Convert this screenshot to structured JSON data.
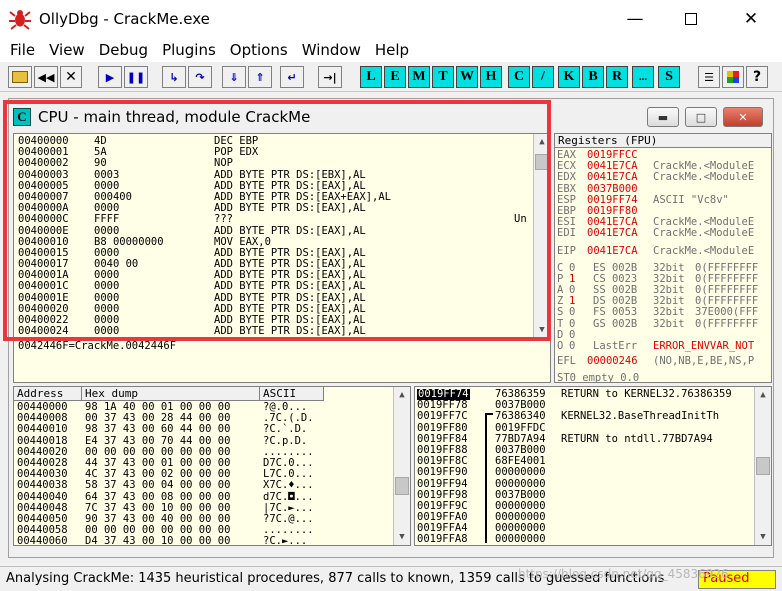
{
  "window": {
    "title": "OllyDbg - CrackMe.exe"
  },
  "menu": [
    "File",
    "View",
    "Debug",
    "Plugins",
    "Options",
    "Window",
    "Help"
  ],
  "toolbar_letters": [
    "L",
    "E",
    "M",
    "T",
    "W",
    "H",
    "C",
    "/",
    "K",
    "B",
    "R",
    "...",
    "S"
  ],
  "cpu": {
    "title": "CPU - main thread, module CrackMe"
  },
  "disasm": {
    "rows": [
      {
        "addr": "00400000",
        "hex": "4D",
        "instr": "DEC EBP"
      },
      {
        "addr": "00400001",
        "hex": "5A",
        "instr": "POP EDX"
      },
      {
        "addr": "00400002",
        "hex": "90",
        "instr": "NOP"
      },
      {
        "addr": "00400003",
        "hex": "0003",
        "instr": "ADD BYTE PTR DS:[EBX],AL"
      },
      {
        "addr": "00400005",
        "hex": "0000",
        "instr": "ADD BYTE PTR DS:[EAX],AL"
      },
      {
        "addr": "00400007",
        "hex": "000400",
        "instr": "ADD BYTE PTR DS:[EAX+EAX],AL"
      },
      {
        "addr": "0040000A",
        "hex": "0000",
        "instr": "ADD BYTE PTR DS:[EAX],AL"
      },
      {
        "addr": "0040000C",
        "hex": "FFFF",
        "instr": "???"
      },
      {
        "addr": "0040000E",
        "hex": "0000",
        "instr": "ADD BYTE PTR DS:[EAX],AL"
      },
      {
        "addr": "00400010",
        "hex": "B8 00000000",
        "instr": "MOV EAX,0"
      },
      {
        "addr": "00400015",
        "hex": "0000",
        "instr": "ADD BYTE PTR DS:[EAX],AL"
      },
      {
        "addr": "00400017",
        "hex": "0040 00",
        "instr": "ADD BYTE PTR DS:[EAX],AL"
      },
      {
        "addr": "0040001A",
        "hex": "0000",
        "instr": "ADD BYTE PTR DS:[EAX],AL"
      },
      {
        "addr": "0040001C",
        "hex": "0000",
        "instr": "ADD BYTE PTR DS:[EAX],AL"
      },
      {
        "addr": "0040001E",
        "hex": "0000",
        "instr": "ADD BYTE PTR DS:[EAX],AL"
      },
      {
        "addr": "00400020",
        "hex": "0000",
        "instr": "ADD BYTE PTR DS:[EAX],AL"
      },
      {
        "addr": "00400022",
        "hex": "0000",
        "instr": "ADD BYTE PTR DS:[EAX],AL"
      },
      {
        "addr": "00400024",
        "hex": "0000",
        "instr": "ADD BYTE PTR DS:[EAX],AL"
      }
    ],
    "comment": "Un",
    "info_line": "0042446F=CrackMe.0042446F"
  },
  "registers": {
    "header": "Registers (FPU)",
    "rows": [
      {
        "name": "EAX",
        "value": "0019FFCC",
        "comment": ""
      },
      {
        "name": "ECX",
        "value": "0041E7CA",
        "comment": "CrackMe.<ModuleE"
      },
      {
        "name": "EDX",
        "value": "0041E7CA",
        "comment": "CrackMe.<ModuleE"
      },
      {
        "name": "EBX",
        "value": "0037B000",
        "comment": ""
      },
      {
        "name": "ESP",
        "value": "0019FF74",
        "comment": "ASCII \"Vc8v\""
      },
      {
        "name": "EBP",
        "value": "0019FF80",
        "comment": ""
      },
      {
        "name": "ESI",
        "value": "0041E7CA",
        "comment": "CrackMe.<ModuleE"
      },
      {
        "name": "EDI",
        "value": "0041E7CA",
        "comment": "CrackMe.<ModuleE"
      },
      {
        "name": "EIP",
        "value": "0041E7CA",
        "comment": "CrackMe.<ModuleE"
      }
    ],
    "flags": [
      {
        "f": "C",
        "v": "0",
        "seg": "ES 002B",
        "bits": "32bit",
        "base": "0(FFFFFFFF"
      },
      {
        "f": "P",
        "v": "1",
        "seg": "CS 0023",
        "bits": "32bit",
        "base": "0(FFFFFFFF"
      },
      {
        "f": "A",
        "v": "0",
        "seg": "SS 002B",
        "bits": "32bit",
        "base": "0(FFFFFFFF"
      },
      {
        "f": "Z",
        "v": "1",
        "seg": "DS 002B",
        "bits": "32bit",
        "base": "0(FFFFFFFF"
      },
      {
        "f": "S",
        "v": "0",
        "seg": "FS 0053",
        "bits": "32bit",
        "base": "37E000(FFF"
      },
      {
        "f": "T",
        "v": "0",
        "seg": "GS 002B",
        "bits": "32bit",
        "base": "0(FFFFFFFF"
      },
      {
        "f": "D",
        "v": "0",
        "seg": "",
        "bits": "",
        "base": ""
      }
    ],
    "lasterr": {
      "f": "O",
      "v": "0",
      "label": "LastErr",
      "value": "ERROR_ENVVAR_NOT"
    },
    "efl": {
      "label": "EFL",
      "value": "00000246",
      "desc": "(NO,NB,E,BE,NS,P"
    },
    "st0": "ST0 empty 0.0"
  },
  "dump": {
    "headers": [
      "Address",
      "Hex dump",
      "ASCII"
    ],
    "rows": [
      {
        "addr": "00440000",
        "hex": "98 1A 40 00 01 00 00 00",
        "ascii": "?@.0..."
      },
      {
        "addr": "00440008",
        "hex": "00 37 43 00 28 44 00 00",
        "ascii": ".7C.(.D."
      },
      {
        "addr": "00440010",
        "hex": "98 37 43 00 60 44 00 00",
        "ascii": "?C.`.D."
      },
      {
        "addr": "00440018",
        "hex": "E4 37 43 00 70 44 00 00",
        "ascii": "?C.p.D."
      },
      {
        "addr": "00440020",
        "hex": "00 00 00 00 00 00 00 00",
        "ascii": "........"
      },
      {
        "addr": "00440028",
        "hex": "44 37 43 00 01 00 00 00",
        "ascii": "D7C.0..."
      },
      {
        "addr": "00440030",
        "hex": "4C 37 43 00 02 00 00 00",
        "ascii": "L7C.0..."
      },
      {
        "addr": "00440038",
        "hex": "58 37 43 00 04 00 00 00",
        "ascii": "X7C.♦..."
      },
      {
        "addr": "00440040",
        "hex": "64 37 43 00 08 00 00 00",
        "ascii": "d7C.◘..."
      },
      {
        "addr": "00440048",
        "hex": "7C 37 43 00 10 00 00 00",
        "ascii": "|7C.►..."
      },
      {
        "addr": "00440050",
        "hex": "90 37 43 00 40 00 00 00",
        "ascii": "?7C.@..."
      },
      {
        "addr": "00440058",
        "hex": "00 00 00 00 00 00 00 00",
        "ascii": "........"
      },
      {
        "addr": "00440060",
        "hex": "D4 37 43 00 10 00 00 00",
        "ascii": "?C.►..."
      }
    ]
  },
  "stack": {
    "rows": [
      {
        "addr": "0019FF74",
        "val": "76386359",
        "comment": "RETURN to KERNEL32.76386359"
      },
      {
        "addr": "0019FF78",
        "val": "0037B000",
        "comment": ""
      },
      {
        "addr": "0019FF7C",
        "val": "76386340",
        "comment": "KERNEL32.BaseThreadInitTh"
      },
      {
        "addr": "0019FF80",
        "val": "0019FFDC",
        "comment": ""
      },
      {
        "addr": "0019FF84",
        "val": "77BD7A94",
        "comment": "RETURN to ntdll.77BD7A94"
      },
      {
        "addr": "0019FF88",
        "val": "0037B000",
        "comment": ""
      },
      {
        "addr": "0019FF8C",
        "val": "68FE4001",
        "comment": ""
      },
      {
        "addr": "0019FF90",
        "val": "00000000",
        "comment": ""
      },
      {
        "addr": "0019FF94",
        "val": "00000000",
        "comment": ""
      },
      {
        "addr": "0019FF98",
        "val": "0037B000",
        "comment": ""
      },
      {
        "addr": "0019FF9C",
        "val": "00000000",
        "comment": ""
      },
      {
        "addr": "0019FFA0",
        "val": "00000000",
        "comment": ""
      },
      {
        "addr": "0019FFA4",
        "val": "00000000",
        "comment": ""
      },
      {
        "addr": "0019FFA8",
        "val": "00000000",
        "comment": ""
      }
    ]
  },
  "status": {
    "text": "Analysing CrackMe: 1435 heuristical procedures, 877 calls to known, 1359 calls to guessed functions",
    "state": "Paused",
    "watermark": "https://blog.csdn.net/qq_45836926"
  }
}
